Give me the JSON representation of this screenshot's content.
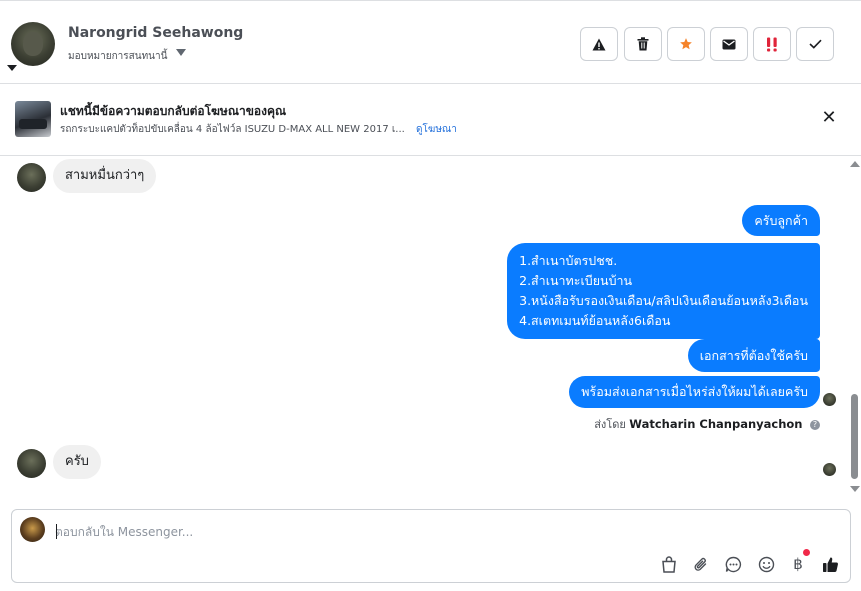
{
  "header": {
    "name": "Narongrid Seehawong",
    "assign_label": "มอบหมายการสนทนานี้",
    "toolbar": {
      "spam_icon": "warning-icon",
      "trash_icon": "trash-icon",
      "star_icon": "star-icon",
      "mail_icon": "envelope-icon",
      "urgent_icon": "exclamation-icon",
      "done_icon": "check-icon"
    }
  },
  "ad": {
    "title": "แชทนี้มีข้อความตอบกลับต่อโฆษณาของคุณ",
    "description": "รถกระบะแคปตัวท็อปขับเคลื่อน 4 ล้อไฟว์ล ISUZU D-MAX ALL NEW 2017 เ...",
    "link_label": "ดูโฆษณา"
  },
  "messages": {
    "incoming_1": "สามหมื่นกว่าๆ",
    "outgoing_1": "ครับลูกค้า",
    "outgoing_2_lines": [
      "1.สำเนาบัตรปชช.",
      "2.สำเนาทะเบียนบ้าน",
      "3.หนังสือรับรองเงินเดือน/สลิปเงินเดือนย้อนหลัง3เดือน",
      "4.สเตทเมนท์ย้อนหลัง6เดือน"
    ],
    "outgoing_3": "เอกสารที่ต้องใช้ครับ",
    "outgoing_4": "พร้อมส่งเอกสารเมื่อไหร่ส่งให้ผมได้เลยครับ",
    "sent_by_prefix": "ส่งโดย",
    "sent_by_name": "Watcharin Chanpanyachon",
    "incoming_2": "ครับ"
  },
  "composer": {
    "placeholder": "ตอบกลับใน Messenger..."
  },
  "colors": {
    "outgoing_bubble": "#0a7cff",
    "incoming_bubble": "#f0f0f0",
    "star": "#f5832a",
    "urgent": "#e0243a",
    "link": "#216fdb"
  }
}
